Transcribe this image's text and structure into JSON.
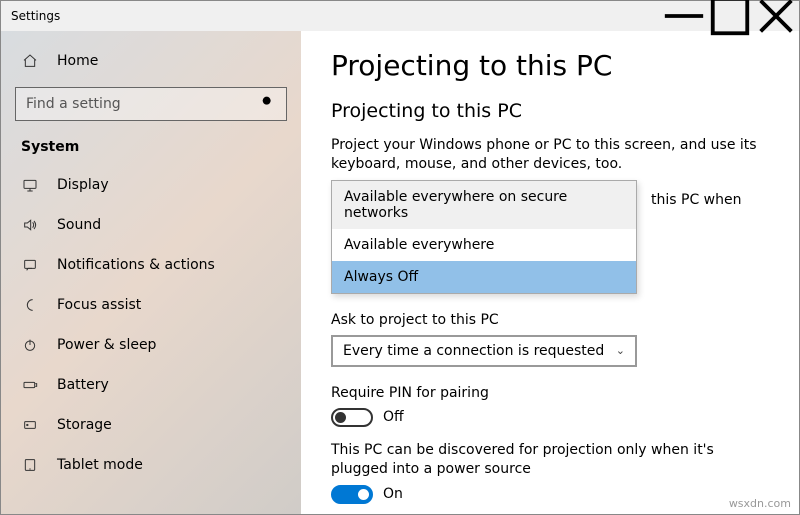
{
  "window": {
    "title": "Settings"
  },
  "sidebar": {
    "home": "Home",
    "search_placeholder": "Find a setting",
    "category": "System",
    "items": [
      {
        "label": "Display"
      },
      {
        "label": "Sound"
      },
      {
        "label": "Notifications & actions"
      },
      {
        "label": "Focus assist"
      },
      {
        "label": "Power & sleep"
      },
      {
        "label": "Battery"
      },
      {
        "label": "Storage"
      },
      {
        "label": "Tablet mode"
      }
    ]
  },
  "main": {
    "title": "Projecting to this PC",
    "subtitle": "Projecting to this PC",
    "description": "Project your Windows phone or PC to this screen, and use its keyboard, mouse, and other devices, too.",
    "dropdown1": {
      "behind_fragment": "this PC when",
      "options": [
        "Available everywhere on secure networks",
        "Available everywhere",
        "Always Off"
      ]
    },
    "ask_label": "Ask to project to this PC",
    "ask_value": "Every time a connection is requested",
    "pin_label": "Require PIN for pairing",
    "pin_state": "Off",
    "discover_label": "This PC can be discovered for projection only when it's plugged into a power source",
    "discover_state": "On"
  },
  "watermark": "wsxdn.com"
}
